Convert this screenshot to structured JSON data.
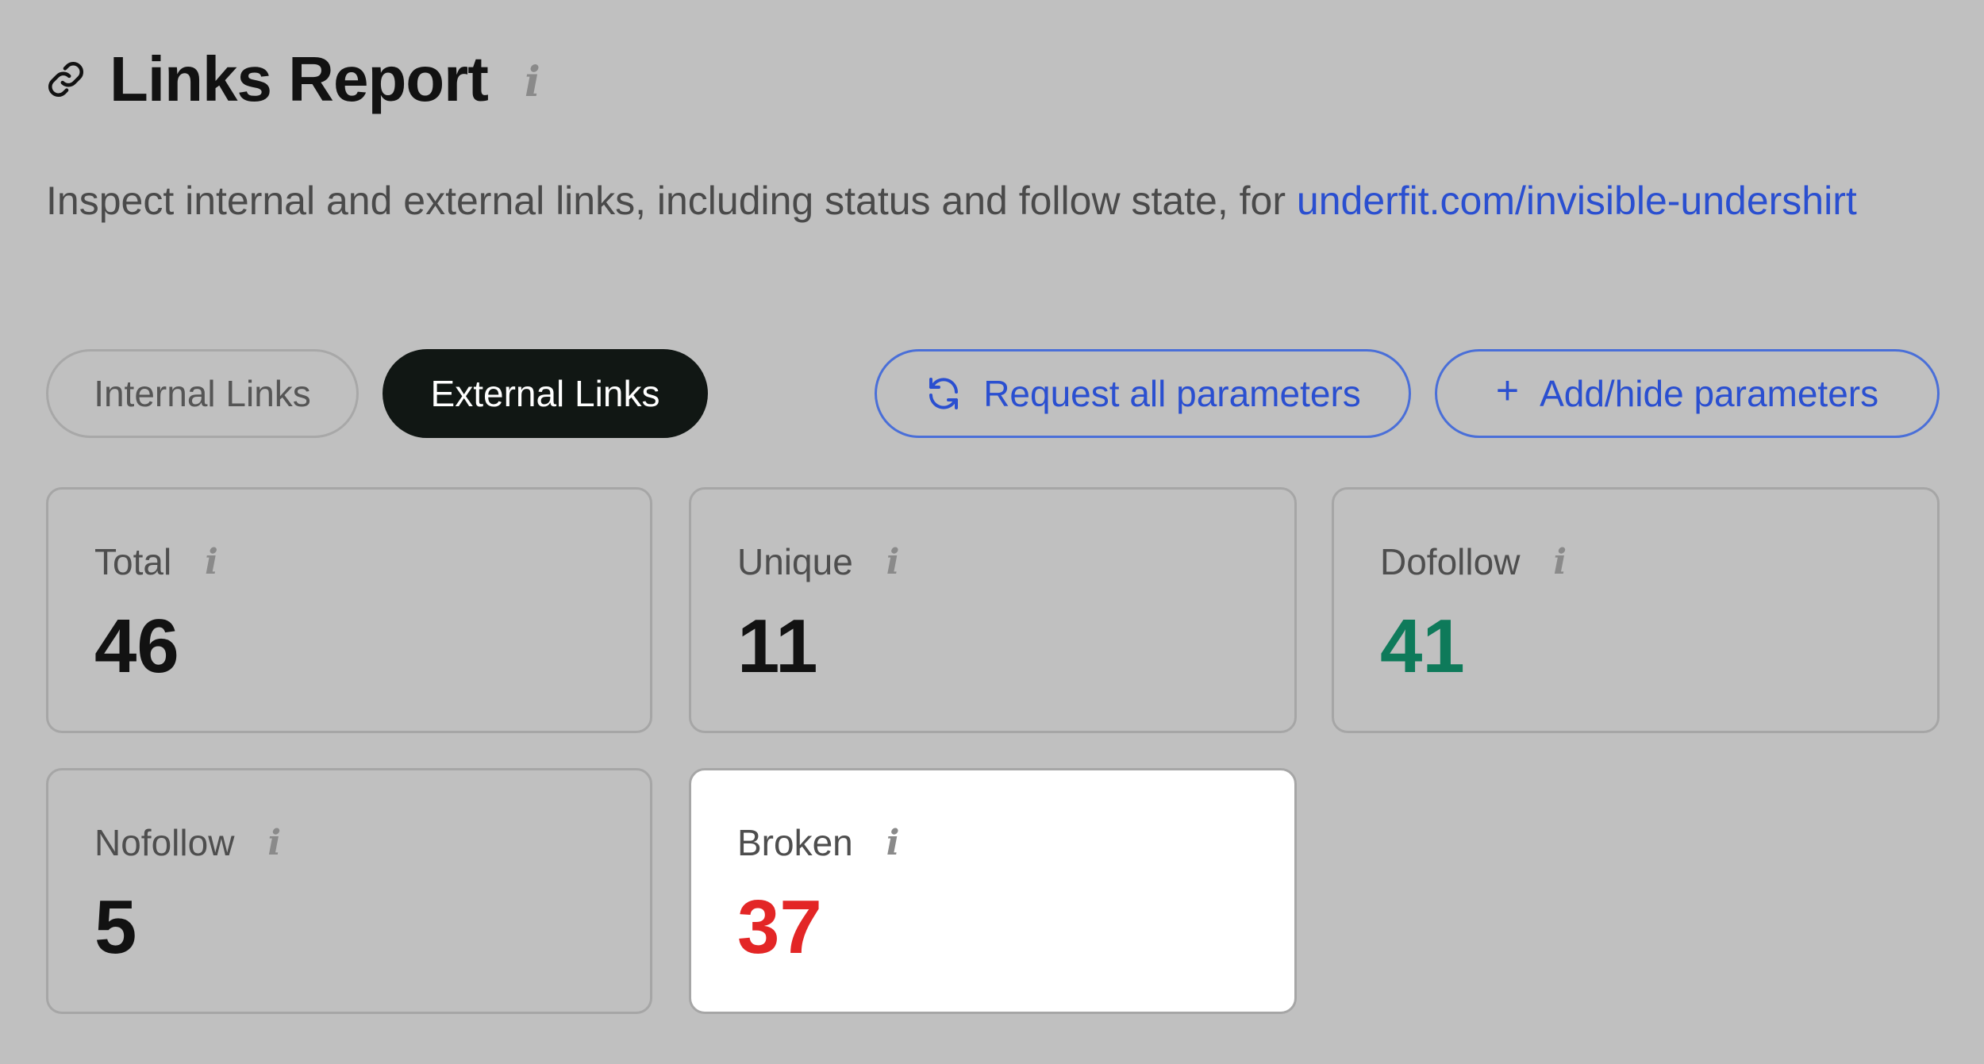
{
  "header": {
    "title": "Links Report",
    "info": "i"
  },
  "description": {
    "text": "Inspect internal and external links, including status and follow state, for ",
    "link": "underfit.com/invisible-undershirt"
  },
  "tabs": [
    {
      "label": "Internal Links",
      "active": false
    },
    {
      "label": "External Links",
      "active": true
    }
  ],
  "actions": {
    "request_label": "Request all parameters",
    "add_label": "Add/hide parameters",
    "add_symbol": "+"
  },
  "stats": {
    "total": {
      "label": "Total",
      "value": "46",
      "color": "#121212"
    },
    "unique": {
      "label": "Unique",
      "value": "11",
      "color": "#121212"
    },
    "dofollow": {
      "label": "Dofollow",
      "value": "41",
      "color": "#0e7a5a"
    },
    "nofollow": {
      "label": "Nofollow",
      "value": "5",
      "color": "#121212"
    },
    "broken": {
      "label": "Broken",
      "value": "37",
      "color": "#e32626"
    }
  },
  "info_glyph": "i",
  "colors": {
    "background": "#c0c0c0",
    "accent": "#2a4fd0",
    "active_tab": "#111714",
    "success": "#0e7a5a",
    "error": "#e32626"
  },
  "icons": {
    "header": "link-icon",
    "request": "refresh-icon",
    "add": "plus-icon",
    "info": "info-icon"
  }
}
